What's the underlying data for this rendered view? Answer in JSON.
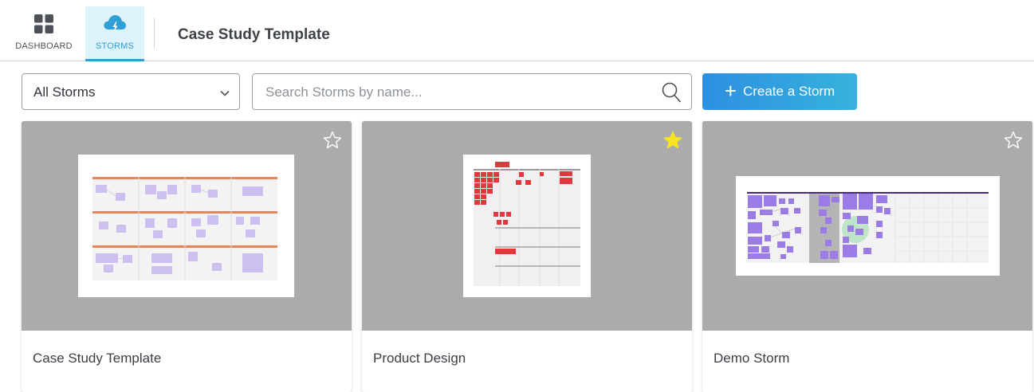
{
  "nav": {
    "items": [
      {
        "label": "DASHBOARD",
        "icon": "dashboard-grid-icon",
        "active": false
      },
      {
        "label": "STORMS",
        "icon": "cloud-lightning-icon",
        "active": true
      }
    ]
  },
  "header": {
    "title": "Case Study Template"
  },
  "toolbar": {
    "filter_value": "All Storms",
    "search_placeholder": "Search Storms by name...",
    "create_label": "Create a Storm"
  },
  "cards": [
    {
      "name": "Case Study Template",
      "favorite": false,
      "thumbnail": "board-grid-preview"
    },
    {
      "name": "Product Design",
      "favorite": true,
      "thumbnail": "board-red-notes-preview"
    },
    {
      "name": "Demo Storm",
      "favorite": false,
      "thumbnail": "board-purple-notes-preview"
    }
  ],
  "colors": {
    "accent": "#2f9fd6",
    "button_gradient_start": "#2d8fe0",
    "button_gradient_end": "#37b2dc",
    "thumb_bg": "#ababab",
    "favorite_star": "#f7e324"
  }
}
